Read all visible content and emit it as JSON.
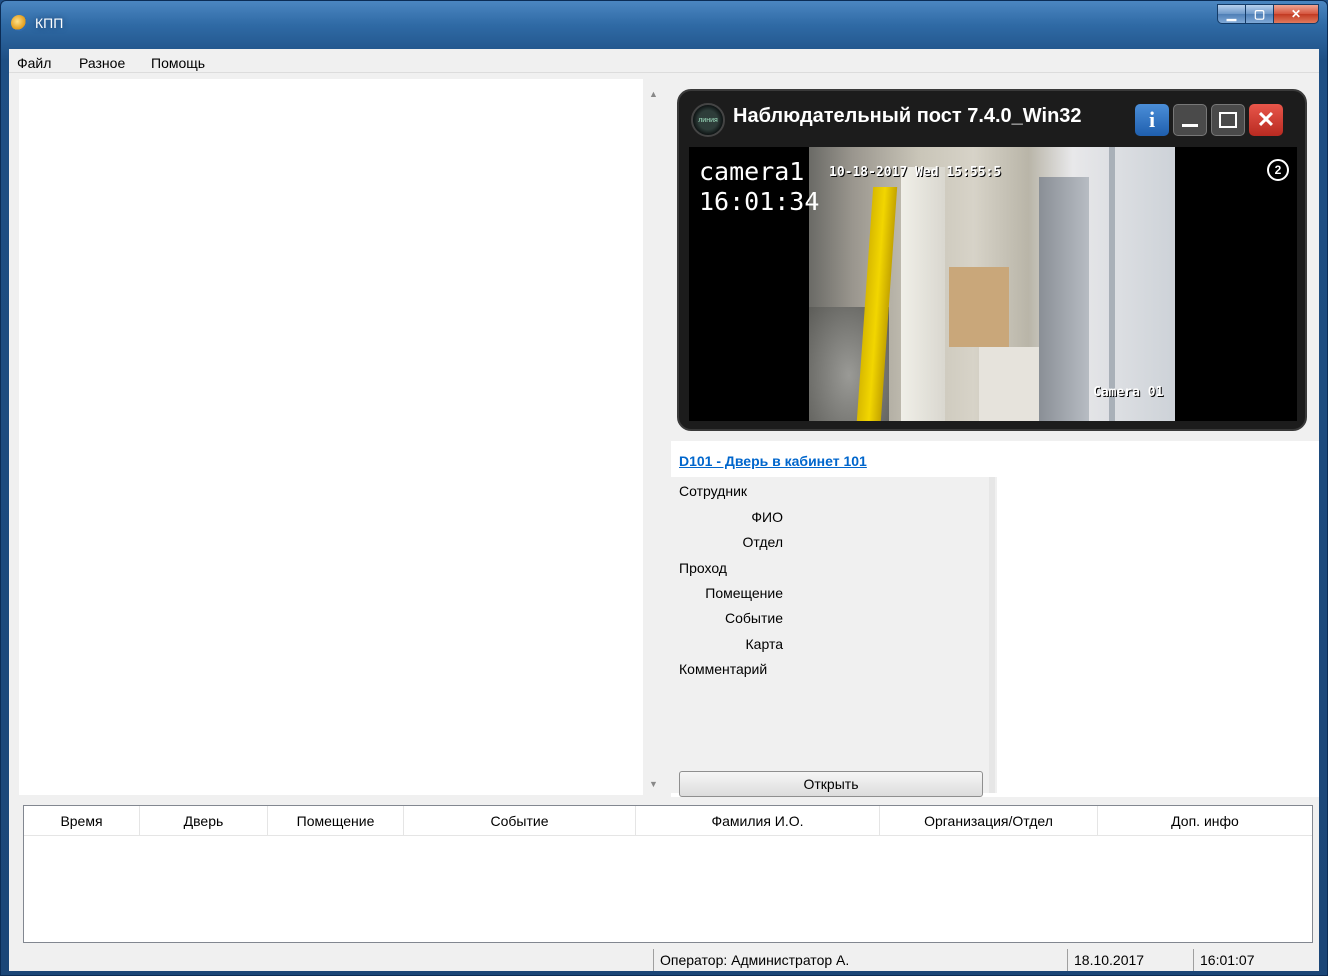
{
  "window": {
    "title": "КПП"
  },
  "menu": [
    "Файл",
    "Разное",
    "Помощь"
  ],
  "video": {
    "title": "Наблюдательный пост 7.4.0_Win32",
    "logo_text": "линия",
    "info_label": "i",
    "camera_name": "camera1",
    "camera_time": "16:01:34",
    "osd_date": "10-18-2017 Wed 15:55:5",
    "osd_camera": "Camera 01",
    "record_badge": "2"
  },
  "details": {
    "door_link": "D101 - Дверь в кабинет 101",
    "fields": [
      "Сотрудник",
      "ФИО",
      "Отдел",
      "Проход",
      "Помещение",
      "Событие",
      "Карта",
      "Комментарий"
    ],
    "open_button": "Открыть"
  },
  "events": {
    "columns": [
      "Время",
      "Дверь",
      "Помещение",
      "Событие",
      "Фамилия И.О.",
      "Организация/Отдел",
      "Доп. инфо"
    ]
  },
  "status": {
    "operator": "Оператор: Администратор А.",
    "date": "18.10.2017",
    "time": "16:01:07"
  }
}
